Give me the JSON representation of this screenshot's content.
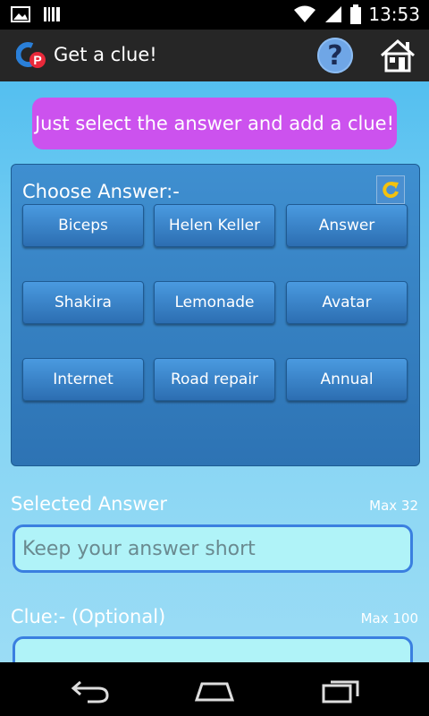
{
  "status_bar": {
    "time": "13:53",
    "icons": [
      "image-icon",
      "barcode-icon",
      "wifi-icon",
      "signal-icon",
      "battery-icon"
    ]
  },
  "action_bar": {
    "title": "Get a clue!",
    "logo_text": "CP",
    "help_label": "?",
    "icons": [
      "app-logo-icon",
      "help-icon",
      "home-icon"
    ]
  },
  "banner": {
    "text": "Just select the answer and add a clue!"
  },
  "answer_panel": {
    "label": "Choose Answer:-",
    "refresh_icon": "refresh-icon",
    "answers": [
      "Biceps",
      "Helen Keller",
      "Answer",
      "Shakira",
      "Lemonade",
      "Avatar",
      "Internet",
      "Road repair",
      "Annual"
    ]
  },
  "selected_answer": {
    "label": "Selected Answer",
    "max_label": "Max 32",
    "placeholder": "Keep your answer short"
  },
  "clue": {
    "label": "Clue:- (Optional)",
    "max_label": "Max 100"
  },
  "nav_bar": {
    "icons": [
      "back-icon",
      "home-nav-icon",
      "recents-icon"
    ]
  },
  "colors": {
    "banner": "#cc52ee",
    "panel": "#2d73b4",
    "input_bg": "#b0f3f8",
    "background": "#54bff0"
  }
}
